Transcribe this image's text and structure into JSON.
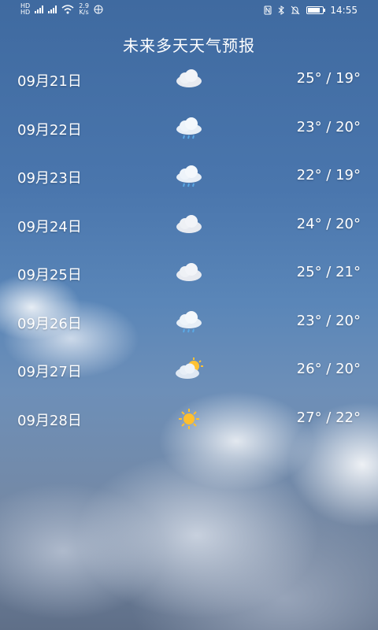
{
  "status_bar": {
    "net_speed_value": "2.9",
    "net_speed_unit": "K/s",
    "time": "14:55",
    "battery_level": 0.85
  },
  "title": "未来多天天气预报",
  "forecast": [
    {
      "date": "09月21日",
      "icon": "cloudy-icon",
      "temp": "25° / 19°"
    },
    {
      "date": "09月22日",
      "icon": "light-rain-icon",
      "temp": "23° / 20°"
    },
    {
      "date": "09月23日",
      "icon": "light-rain-icon",
      "temp": "22° / 19°"
    },
    {
      "date": "09月24日",
      "icon": "cloudy-icon",
      "temp": "24° / 20°"
    },
    {
      "date": "09月25日",
      "icon": "cloudy-icon",
      "temp": "25° / 21°"
    },
    {
      "date": "09月26日",
      "icon": "light-rain-icon",
      "temp": "23° / 20°"
    },
    {
      "date": "09月27日",
      "icon": "partly-cloudy-icon",
      "temp": "26° / 20°"
    },
    {
      "date": "09月28日",
      "icon": "sunny-icon",
      "temp": "27° / 22°"
    }
  ]
}
